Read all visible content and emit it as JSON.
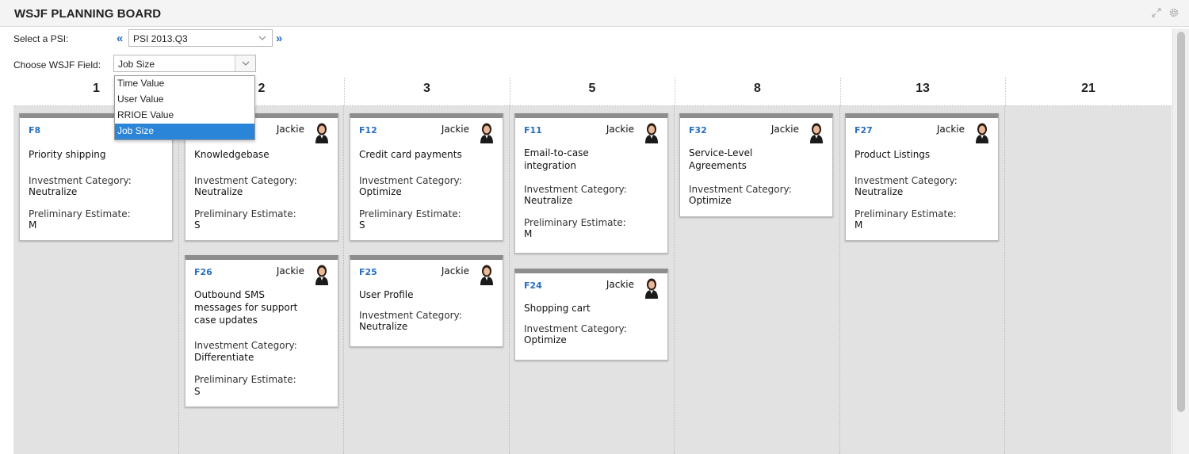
{
  "header": {
    "title": "WSJF PLANNING BOARD",
    "icons": [
      "expand-icon",
      "gear-icon"
    ]
  },
  "psi": {
    "label": "Select a PSI:",
    "prev": "«",
    "next": "»",
    "value": "PSI 2013.Q3"
  },
  "wsjf": {
    "label": "Choose WSJF Field:",
    "value": "Job Size",
    "options": [
      "Time Value",
      "User Value",
      "RRIOE Value",
      "Job Size"
    ],
    "selected_option": "Job Size"
  },
  "columns": [
    "1",
    "2",
    "3",
    "5",
    "8",
    "13",
    "21"
  ],
  "cards": [
    {
      "id": "F8",
      "owner": "",
      "name": "Priority shipping",
      "cat_label": "Investment Category:",
      "cat": "Neutralize",
      "est_label": "Preliminary Estimate:",
      "est": "M"
    },
    {
      "id": "",
      "owner": "Jackie",
      "name": "Knowledgebase",
      "cat_label": "Investment Category:",
      "cat": "Neutralize",
      "est_label": "Preliminary Estimate:",
      "est": "S"
    },
    {
      "id": "F26",
      "owner": "Jackie",
      "name": "Outbound SMS messages for support case updates",
      "cat_label": "Investment Category:",
      "cat": "Differentiate",
      "est_label": "Preliminary Estimate:",
      "est": "S"
    },
    {
      "id": "F12",
      "owner": "Jackie",
      "name": "Credit card payments",
      "cat_label": "Investment Category:",
      "cat": "Optimize",
      "est_label": "Preliminary Estimate:",
      "est": "S"
    },
    {
      "id": "F25",
      "owner": "Jackie",
      "name": "User Profile",
      "cat_label": "Investment Category:",
      "cat": "Neutralize",
      "est_label": "",
      "est": ""
    },
    {
      "id": "F11",
      "owner": "Jackie",
      "name": "Email-to-case integration",
      "cat_label": "Investment Category:",
      "cat": "Neutralize",
      "est_label": "Preliminary Estimate:",
      "est": "M"
    },
    {
      "id": "F24",
      "owner": "Jackie",
      "name": "Shopping cart",
      "cat_label": "Investment Category:",
      "cat": "Optimize",
      "est_label": "",
      "est": ""
    },
    {
      "id": "F32",
      "owner": "Jackie",
      "name": "Service-Level Agreements",
      "cat_label": "Investment Category:",
      "cat": "Optimize",
      "est_label": "",
      "est": ""
    },
    {
      "id": "F27",
      "owner": "Jackie",
      "name": "Product Listings",
      "cat_label": "Investment Category:",
      "cat": "Neutralize",
      "est_label": "Preliminary Estimate:",
      "est": "M"
    }
  ],
  "colors": {
    "accent": "#2a6fc0",
    "selection": "#2a85d8",
    "board_bg": "#e2e2e2",
    "card_top": "#8d8d8d"
  }
}
